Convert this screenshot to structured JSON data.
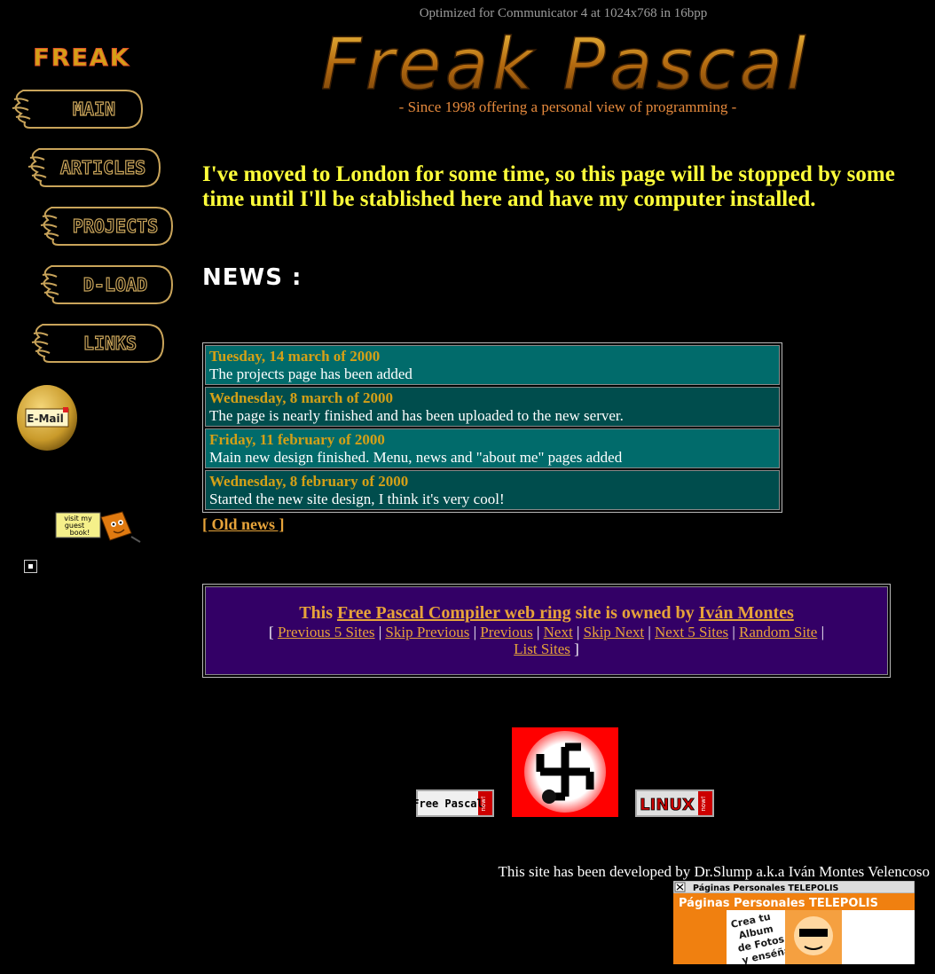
{
  "header": {
    "optimized_text": "Optimized for Communicator 4 at 1024x768 in 16bpp",
    "logo_text": "Freak Pascal",
    "small_logo_text": "FREAK",
    "tagline": "- Since 1998 offering a personal view of programming -"
  },
  "nav": {
    "main": "MAIN",
    "articles": "ARTICLES",
    "projects": "PROJECTS",
    "dload": "D-LOAD",
    "links": "LINKS",
    "email": "E-Mail",
    "guestbook": "visit my guest book!"
  },
  "notice": "I've moved to London for some time, so this page will be stopped by some time until I'll be stablished here and have my computer installed.",
  "news": {
    "title": "NEWS :",
    "items": [
      {
        "date": "Tuesday, 14 march of 2000",
        "text": "The projects page has been added"
      },
      {
        "date": "Wednesday, 8 march of 2000",
        "text": "The page is nearly finished and has been uploaded to the new server."
      },
      {
        "date": "Friday, 11 february of 2000",
        "text": "Main new design finished. Menu, news and \"about me\" pages added"
      },
      {
        "date": "Wednesday, 8 february of 2000",
        "text": "Started the new site design, I think it's very cool!"
      }
    ],
    "old_news": "[ Old news ]"
  },
  "webring": {
    "title_this": "This ",
    "ring_name": "Free Pascal Compiler web ring",
    "title_mid": " site is owned by ",
    "owner": "Iván Montes",
    "open_bracket": "[ ",
    "close_bracket": " ]",
    "links": [
      "Previous 5 Sites",
      "Skip Previous",
      "Previous",
      "Next",
      "Skip Next",
      "Next 5 Sites",
      "Random Site",
      "List Sites"
    ]
  },
  "badges": {
    "freepascal": "Free Pascal",
    "freepascal_tag": "now!",
    "linux": "LINUX",
    "linux_tag": "now!"
  },
  "footer": {
    "credit": "This site has been developed by Dr.Slump a.k.a Iván Montes Velencoso"
  },
  "ad": {
    "top_text": "Páginas Personales TELEPOLIS",
    "main_text": "Páginas Personales TELEPOLIS",
    "lines": [
      "Crea tu",
      "Album",
      "de Fotos",
      "y enséñalo"
    ]
  },
  "colors": {
    "background": "#000000",
    "notice": "#ffff3a",
    "link": "#e6a33a",
    "news_date": "#d4a017",
    "news_row_a": "#016b6b",
    "news_row_b": "#004d4d",
    "webring_bg": "#330066"
  }
}
